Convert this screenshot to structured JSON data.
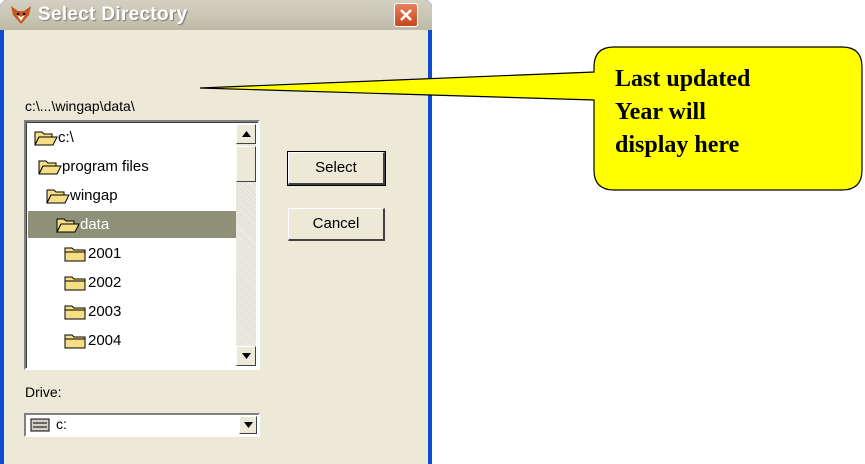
{
  "window": {
    "title": "Select Directory"
  },
  "path_label": "c:\\...\\wingap\\data\\",
  "directory_list": {
    "items": [
      {
        "label": "c:\\",
        "icon": "open-folder-icon",
        "selected": false
      },
      {
        "label": "program files",
        "icon": "open-folder-icon",
        "selected": false
      },
      {
        "label": "wingap",
        "icon": "open-folder-icon",
        "selected": false
      },
      {
        "label": "data",
        "icon": "open-folder-icon",
        "selected": true
      },
      {
        "label": "2001",
        "icon": "folder-icon",
        "selected": false
      },
      {
        "label": "2002",
        "icon": "folder-icon",
        "selected": false
      },
      {
        "label": "2003",
        "icon": "folder-icon",
        "selected": false
      },
      {
        "label": "2004",
        "icon": "folder-icon",
        "selected": false
      }
    ]
  },
  "buttons": {
    "select_label": "Select",
    "cancel_label": "Cancel"
  },
  "drive": {
    "label": "Drive:",
    "value": "c:"
  },
  "callout": {
    "line1": "Last updated",
    "line2": "Year will",
    "line3": "display here",
    "fill_color": "#ffff00"
  },
  "colors": {
    "selection": "#8e9178",
    "folder_fill": "#f6de84",
    "close_button": "#d25a33"
  }
}
